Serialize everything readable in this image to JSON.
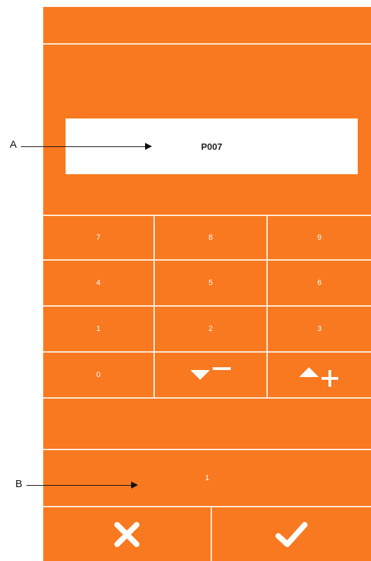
{
  "display": {
    "value": "P007"
  },
  "keypad": {
    "keys": [
      {
        "label": "7"
      },
      {
        "label": "8"
      },
      {
        "label": "9"
      },
      {
        "label": "4"
      },
      {
        "label": "5"
      },
      {
        "label": "6"
      },
      {
        "label": "1"
      },
      {
        "label": "2"
      },
      {
        "label": "3"
      },
      {
        "label": "0"
      }
    ],
    "decrement_icon": "triangle-down-minus-icon",
    "increment_icon": "triangle-up-plus-icon"
  },
  "value_field": {
    "value": "1"
  },
  "actions": {
    "cancel_icon": "close-icon",
    "confirm_icon": "checkmark-icon"
  },
  "callouts": {
    "a": "A",
    "b": "B"
  },
  "colors": {
    "panel": "#F8791F",
    "display_bg": "#FFFFFF",
    "text_on_panel": "#FFFFFF"
  }
}
